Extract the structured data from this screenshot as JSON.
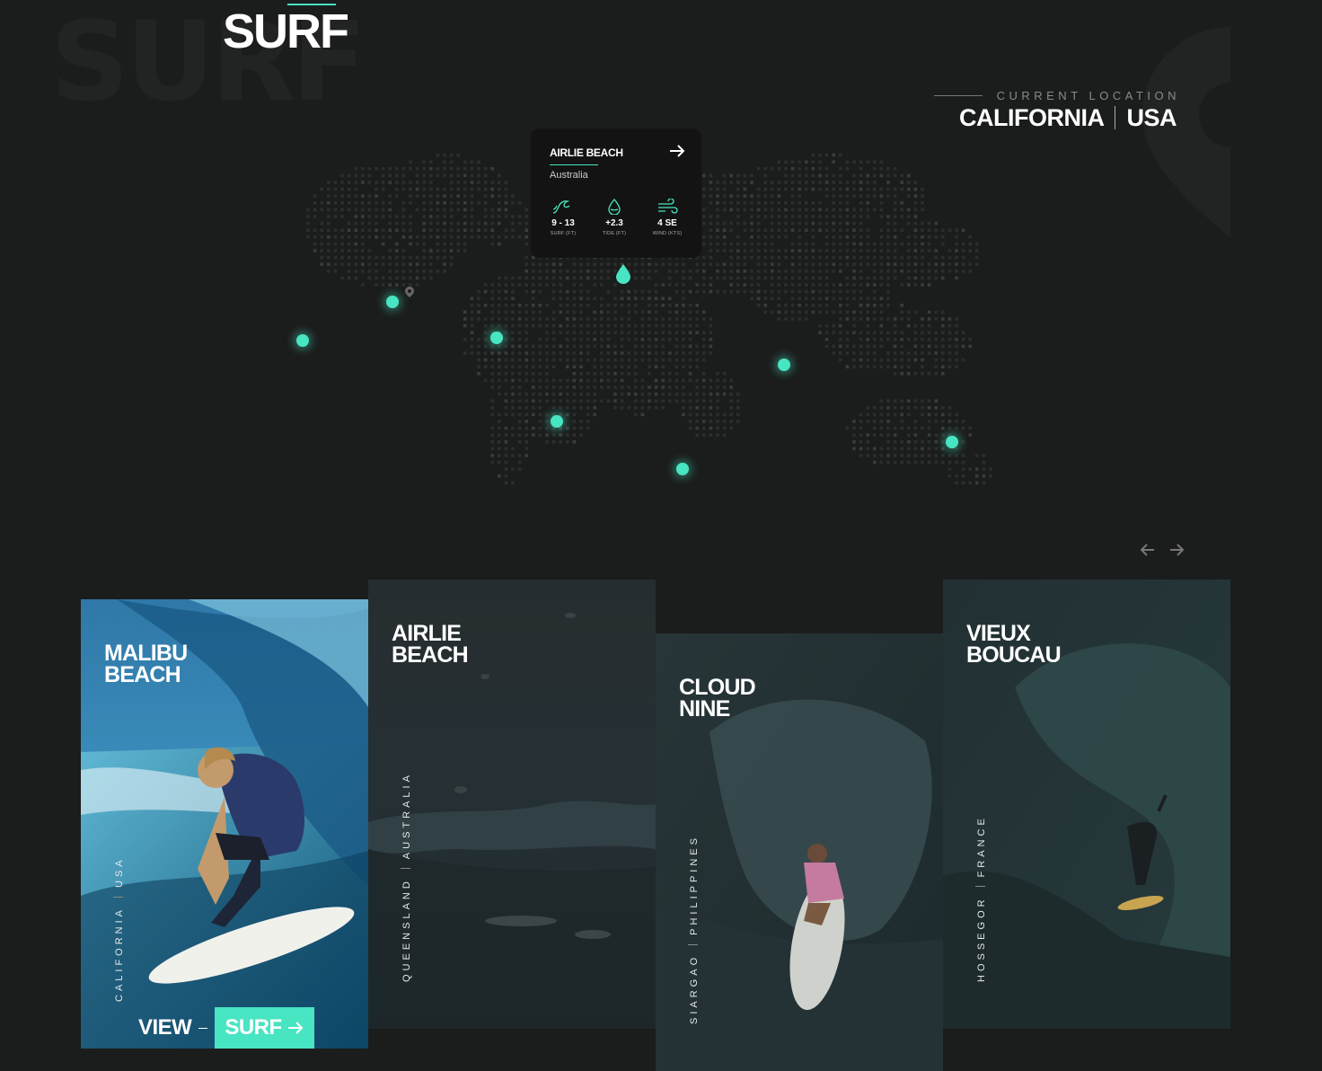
{
  "brand": {
    "title": "SURF",
    "background_word": "SURF"
  },
  "current_location": {
    "label": "CURRENT LOCATION",
    "region": "CALIFORNIA",
    "country": "USA"
  },
  "popup": {
    "title": "AIRLIE BEACH",
    "country": "Australia",
    "stats": [
      {
        "icon": "wave-icon",
        "value": "9 - 13",
        "caption": "SURF (FT)"
      },
      {
        "icon": "tide-drop-icon",
        "value": "+2.3",
        "caption": "TIDE (FT)"
      },
      {
        "icon": "wind-icon",
        "value": "4 SE",
        "caption": "WIND (KTS)"
      }
    ]
  },
  "cards": [
    {
      "title": "MALIBU\nBEACH",
      "region": "CALIFORNIA",
      "country": "USA",
      "active": true
    },
    {
      "title": "AIRLIE\nBEACH",
      "region": "QUEENSLAND",
      "country": "AUSTRALIA"
    },
    {
      "title": "CLOUD\nNINE",
      "region": "SIARGAO",
      "country": "PHILIPPINES"
    },
    {
      "title": "VIEUX\nBOUCAU",
      "region": "HOSSEGOR",
      "country": "FRANCE"
    }
  ],
  "view_button": {
    "view": "VIEW",
    "surf": "SURF"
  },
  "colors": {
    "accent": "#48e5c2",
    "background": "#1b1c1c",
    "popup": "#131313"
  }
}
